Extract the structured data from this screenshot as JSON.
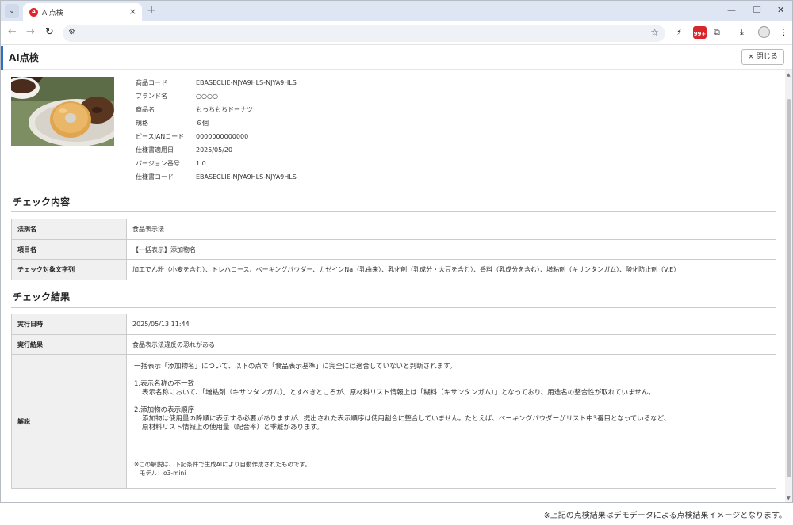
{
  "browser": {
    "tab_title": "AI点検",
    "tab_favicon": "acrobat-icon",
    "new_tab": "+",
    "tab_close": "×",
    "menu": "⌄",
    "minimize": "—",
    "restore": "❐",
    "close": "✕",
    "back": "←",
    "forward": "→",
    "reload": "↻",
    "site_info": "⚙",
    "bookmark": "☆",
    "extension_badge": "99+",
    "download": "⤓",
    "more": "⋮",
    "lightning": "⚡",
    "puzzle": "⧉"
  },
  "header": {
    "title": "AI点検",
    "close_label": "× 閉じる"
  },
  "product": {
    "rows": [
      {
        "label": "商品コード",
        "value": "EBASECLIE-NJYA9HLS-NJYA9HLS"
      },
      {
        "label": "ブランド名",
        "value": "○○○○"
      },
      {
        "label": "商品名",
        "value": "もっちもちドーナツ"
      },
      {
        "label": "規格",
        "value": "６個"
      },
      {
        "label": "ピースJANコード",
        "value": "0000000000000"
      },
      {
        "label": "仕様書適用日",
        "value": "2025/05/20"
      },
      {
        "label": "バージョン番号",
        "value": "1.0"
      },
      {
        "label": "仕様書コード",
        "value": "EBASECLIE-NJYA9HLS-NJYA9HLS"
      }
    ]
  },
  "check_content": {
    "title": "チェック内容",
    "rows": [
      {
        "label": "法規名",
        "value": "食品表示法"
      },
      {
        "label": "項目名",
        "value": "【一括表示】添加物名"
      },
      {
        "label": "チェック対象文字列",
        "value": "加工でん粉（小麦を含む）、トレハロース、ベーキングパウダー、カゼインNa（乳由来）、乳化剤（乳成分・大豆を含む）、香料（乳成分を含む）、増粘剤（キサンタンガム）、酸化防止剤（V.E）"
      }
    ]
  },
  "check_result": {
    "title": "チェック結果",
    "executed_label": "実行日時",
    "executed_value": "2025/05/13 11:44",
    "result_label": "実行結果",
    "result_value": "食品表示法違反の恐れがある",
    "explain_label": "解説",
    "explain_intro": "一括表示「添加物名」について、以下の点で「食品表示基準」に完全には適合していないと判断されます。",
    "point1_title": "1.表示名称の不一致",
    "point1_body": "表示名称において、「増粘剤（キサンタンガム）」とすべきところが、原材料リスト情報上は「糊料（キサンタンガム）」となっており、用途名の整合性が取れていません。",
    "point2_title": "2.添加物の表示順序",
    "point2_body1": "添加物は使用量の降順に表示する必要がありますが、提出された表示順序は使用割合に整合していません。たとえば、ベーキングパウダーがリスト中3番目となっているなど、",
    "point2_body2": "原材料リスト情報上の使用量（配合率）と乖離があります。",
    "note": "※この解説は、下記条件で生成AIにより自動作成されたものです。",
    "model": "モデル：o3-mini"
  },
  "footnote": "※上記の点検結果はデモデータによる点検結果イメージとなります。"
}
